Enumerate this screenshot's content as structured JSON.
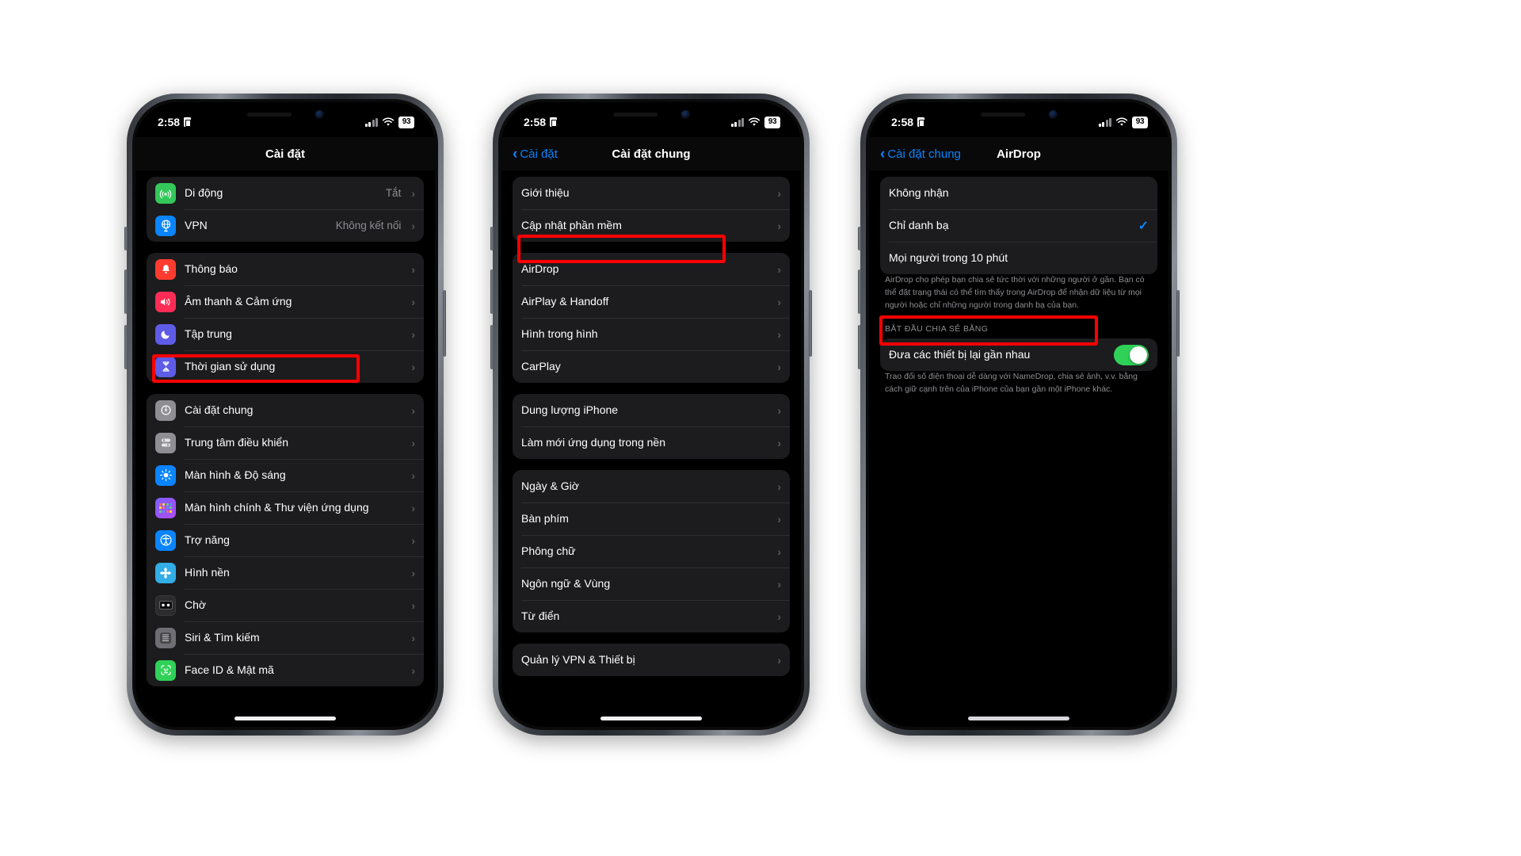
{
  "status_bar": {
    "time": "2:58",
    "lock_icon": "lock-portrait-icon",
    "cell_icon": "cellular-signal-icon",
    "wifi_icon": "wifi-icon",
    "battery": "93"
  },
  "phone1": {
    "nav": {
      "title": "Cài đặt",
      "back": ""
    },
    "groups": [
      {
        "rows": [
          {
            "label": "Di động",
            "value": "Tắt",
            "icon": "cellular-icon",
            "color": "#34c759",
            "glyph": "((p))"
          },
          {
            "label": "VPN",
            "value": "Không kết nối",
            "icon": "vpn-globe-icon",
            "color": "#0a84ff",
            "glyph": "globe"
          }
        ]
      },
      {
        "rows": [
          {
            "label": "Thông báo",
            "value": "",
            "icon": "notifications-bell-icon",
            "color": "#ff3b30",
            "glyph": "bell"
          },
          {
            "label": "Âm thanh & Cảm ứng",
            "value": "",
            "icon": "sounds-haptics-icon",
            "color": "#ff2d55",
            "glyph": "speaker"
          },
          {
            "label": "Tập trung",
            "value": "",
            "icon": "focus-moon-icon",
            "color": "#5e5ce6",
            "glyph": "moon"
          },
          {
            "label": "Thời gian sử dụng",
            "value": "",
            "icon": "screen-time-hourglass-icon",
            "color": "#5e5ce6",
            "glyph": "hourglass"
          }
        ]
      },
      {
        "rows": [
          {
            "label": "Cài đặt chung",
            "value": "",
            "icon": "general-gear-icon",
            "color": "#8e8e93",
            "glyph": "gear",
            "highlighted": true
          },
          {
            "label": "Trung tâm điều khiển",
            "value": "",
            "icon": "control-center-icon",
            "color": "#8e8e93",
            "glyph": "sliders"
          },
          {
            "label": "Màn hình & Độ sáng",
            "value": "",
            "icon": "display-brightness-icon",
            "color": "#0a84ff",
            "glyph": "sun"
          },
          {
            "label": "Màn hình chính & Thư viện ứng dụng",
            "value": "",
            "icon": "home-screen-app-library-icon",
            "color": "#5e5ce6",
            "glyph": "grid"
          },
          {
            "label": "Trợ năng",
            "value": "",
            "icon": "accessibility-icon",
            "color": "#0a84ff",
            "glyph": "accessibility"
          },
          {
            "label": "Hình nền",
            "value": "",
            "icon": "wallpaper-icon",
            "color": "#32ade6",
            "glyph": "flower"
          },
          {
            "label": "Chờ",
            "value": "",
            "icon": "standby-icon",
            "color": "#1c1c1e",
            "glyph": "standby"
          },
          {
            "label": "Siri & Tìm kiếm",
            "value": "",
            "icon": "siri-search-icon",
            "color": "#6e6e73",
            "glyph": "siri"
          },
          {
            "label": "Face ID & Mật mã",
            "value": "",
            "icon": "face-id-icon",
            "color": "#30d158",
            "glyph": "faceid"
          }
        ]
      }
    ]
  },
  "phone2": {
    "nav": {
      "title": "Cài đặt chung",
      "back": "Cài đặt"
    },
    "groups": [
      {
        "rows": [
          {
            "label": "Giới thiệu"
          },
          {
            "label": "Cập nhật phần mềm"
          }
        ]
      },
      {
        "rows": [
          {
            "label": "AirDrop",
            "highlighted": true
          },
          {
            "label": "AirPlay & Handoff"
          },
          {
            "label": "Hình trong hình"
          },
          {
            "label": "CarPlay"
          }
        ]
      },
      {
        "rows": [
          {
            "label": "Dung lượng iPhone"
          },
          {
            "label": "Làm mới ứng dụng trong nền"
          }
        ]
      },
      {
        "rows": [
          {
            "label": "Ngày & Giờ"
          },
          {
            "label": "Bàn phím"
          },
          {
            "label": "Phông chữ"
          },
          {
            "label": "Ngôn ngữ & Vùng"
          },
          {
            "label": "Từ điển"
          }
        ]
      },
      {
        "rows": [
          {
            "label": "Quản lý VPN & Thiết bị"
          }
        ]
      }
    ]
  },
  "phone3": {
    "nav": {
      "title": "AirDrop",
      "back": "Cài đặt chung"
    },
    "options": [
      {
        "label": "Không nhận",
        "selected": false
      },
      {
        "label": "Chỉ danh bạ",
        "selected": true
      },
      {
        "label": "Mọi người trong 10 phút",
        "selected": false
      }
    ],
    "description": "AirDrop cho phép bạn chia sẻ tức thời với những người ở gần. Bạn có thể đặt trạng thái có thể tìm thấy trong AirDrop để nhận dữ liệu từ mọi người hoặc chỉ những người trong danh bạ của bạn.",
    "section_header": "BẮT ĐẦU CHIA SẺ BẰNG",
    "toggle_row": {
      "label": "Đưa các thiết bị lại gần nhau",
      "on": true,
      "highlighted": true
    },
    "toggle_footnote": "Trao đổi số điện thoại dễ dàng với NameDrop, chia sẻ ảnh, v.v. bằng cách giữ cạnh trên của iPhone của bạn gần một iPhone khác."
  },
  "colors": {
    "accent": "#0a84ff",
    "highlight": "#ff0000",
    "toggle_on": "#30d158",
    "group_bg": "#1c1c1e",
    "screen_bg": "#000000"
  }
}
